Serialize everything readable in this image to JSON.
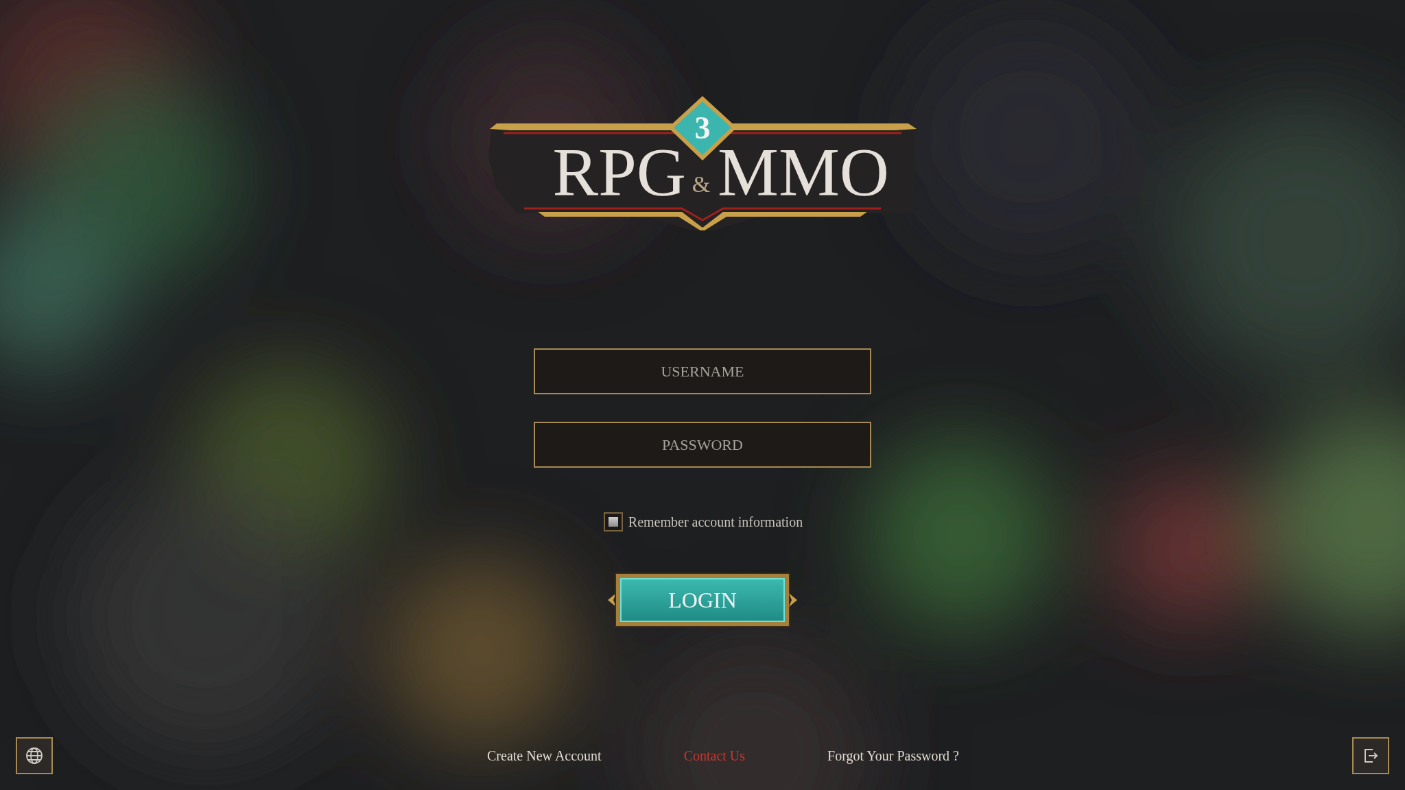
{
  "logo": {
    "badge": "3",
    "word_left": "RPG",
    "ampersand": "&",
    "word_right": "MMO"
  },
  "username": {
    "placeholder": "USERNAME"
  },
  "password": {
    "placeholder": "PASSWORD"
  },
  "remember": {
    "label": "Remember account information",
    "checked": false
  },
  "login_button": "LOGIN",
  "footer_links": [
    {
      "label": "Create New Account",
      "color": "#e2dcd2"
    },
    {
      "label": "Contact Us",
      "color": "#c8372d"
    },
    {
      "label": "Forgot Your Password ?",
      "color": "#e2dcd2"
    }
  ]
}
